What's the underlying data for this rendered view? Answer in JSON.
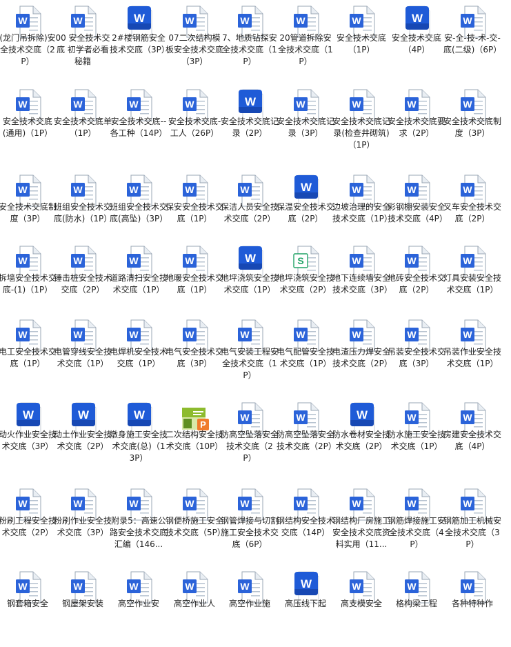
{
  "files": [
    {
      "label": "(龙门吊拆除)安全技术交底（2P）",
      "icon": "word-doc-icon"
    },
    {
      "label": "00 安全技术交底 初学者必看秘籍",
      "icon": "word-doc-icon"
    },
    {
      "label": "2#楼钢筋安全技术交底（3P）",
      "icon": "word-app-icon"
    },
    {
      "label": "07二次结构模板安全技术交底（3P）",
      "icon": "word-doc-icon"
    },
    {
      "label": "7、地质钻探安全技术交底（1P）",
      "icon": "word-doc-icon"
    },
    {
      "label": "20管道拆除安全技术交底（1P）",
      "icon": "word-doc-icon"
    },
    {
      "label": "安全技术交底（1P）",
      "icon": "word-doc-icon"
    },
    {
      "label": "安全技术交底（4P）",
      "icon": "word-app-icon"
    },
    {
      "label": "安-全-技-术-交-底(二级)（6P）",
      "icon": "word-doc-icon"
    },
    {
      "label": "安全技术交底(通用)（1P）",
      "icon": "word-doc-icon"
    },
    {
      "label": "安全技术交底单（1P）",
      "icon": "word-doc-icon"
    },
    {
      "label": "安全技术交底--各工种（14P）",
      "icon": "word-doc-icon"
    },
    {
      "label": "安全技术交底-工人（26P）",
      "icon": "word-doc-icon"
    },
    {
      "label": "安全技术交底记录（2P）",
      "icon": "word-app-icon"
    },
    {
      "label": "安全技术交底记录（3P）",
      "icon": "word-doc-icon"
    },
    {
      "label": "安全技术交底记录(检查井砌筑)（1P）",
      "icon": "word-doc-icon"
    },
    {
      "label": "安全技术交底要求（2P）",
      "icon": "word-doc-icon"
    },
    {
      "label": "安全技术交底制度（3P）",
      "icon": "word-doc-icon"
    },
    {
      "label": "安全技术交底制度（3P）",
      "icon": "word-doc-icon"
    },
    {
      "label": "班组安全技术交底(防水)（1P）",
      "icon": "word-doc-icon"
    },
    {
      "label": "班组安全技术交底(高坠)（3P）",
      "icon": "word-doc-icon"
    },
    {
      "label": "保安安全技术交底（1P）",
      "icon": "word-doc-icon"
    },
    {
      "label": "保洁人员安全技术交底（2P）",
      "icon": "word-doc-icon"
    },
    {
      "label": "保温安全技术交底（2P）",
      "icon": "word-app-icon"
    },
    {
      "label": "边坡治理的安全技术交底（1P）",
      "icon": "word-doc-icon"
    },
    {
      "label": "彩钢棚安装安全技术交底（4P）",
      "icon": "word-doc-icon"
    },
    {
      "label": "叉车安全技术交底（2P）",
      "icon": "word-doc-icon"
    },
    {
      "label": "拆墙安全技术交底-(1)（1P）",
      "icon": "word-doc-icon"
    },
    {
      "label": "锤击桩安全技术交底（2P）",
      "icon": "word-doc-icon"
    },
    {
      "label": "道路清扫安全技术交底（1P）",
      "icon": "word-doc-icon"
    },
    {
      "label": "地暖安全技术交底（1P）",
      "icon": "word-doc-icon"
    },
    {
      "label": "地坪浇筑安全技术交底（1P）",
      "icon": "word-app-icon"
    },
    {
      "label": "地坪浇筑安全技术交底（2P）",
      "icon": "sheet-doc-icon"
    },
    {
      "label": "地下连续墙安全技术交底（3P）",
      "icon": "word-doc-icon"
    },
    {
      "label": "地砖安全技术交底（2P）",
      "icon": "word-doc-icon"
    },
    {
      "label": "灯具安装安全技术交底（1P）",
      "icon": "word-doc-icon"
    },
    {
      "label": "电工安全技术交底（1P）",
      "icon": "word-doc-icon"
    },
    {
      "label": "电管穿线安全技术交底（1P）",
      "icon": "word-doc-icon"
    },
    {
      "label": "电焊机安全技术交底（1P）",
      "icon": "word-doc-icon"
    },
    {
      "label": "电气安全技术交底（3P）",
      "icon": "word-doc-icon"
    },
    {
      "label": "电气安装工程安全技术交底（1P）",
      "icon": "word-doc-icon"
    },
    {
      "label": "电气配管安全技术交底（1P）",
      "icon": "word-doc-icon"
    },
    {
      "label": "电渣压力焊安全技术交底（2P）",
      "icon": "word-doc-icon"
    },
    {
      "label": "吊装安全技术交底（3P）",
      "icon": "word-doc-icon"
    },
    {
      "label": "吊装作业安全技术交底（1P）",
      "icon": "word-doc-icon"
    },
    {
      "label": "动火作业安全技术交底（3P）",
      "icon": "word-app-icon"
    },
    {
      "label": "动土作业安全技术交底（2P）",
      "icon": "word-app-icon"
    },
    {
      "label": "墩身施工安全技术交底(总)（13P）",
      "icon": "word-app-icon"
    },
    {
      "label": "二次结构安全技术交底（10P）",
      "icon": "thumbnail-icon"
    },
    {
      "label": "防高空坠落安全技术交底（2 P）",
      "icon": "word-doc-icon"
    },
    {
      "label": "防高空坠落安全技术交底（2P）",
      "icon": "word-doc-icon"
    },
    {
      "label": "防水卷材安全技术交底（2P）",
      "icon": "word-app-icon"
    },
    {
      "label": "防水施工安全技术交底（1P）",
      "icon": "word-doc-icon"
    },
    {
      "label": "房建安全技术交底（4P）",
      "icon": "word-doc-icon"
    },
    {
      "label": "粉刷工程安全技术交底（2P）",
      "icon": "word-doc-icon"
    },
    {
      "label": "粉刷作业安全技术交底（3P）",
      "icon": "word-doc-icon"
    },
    {
      "label": "附录5：高速公路安全技术交底汇编（146...",
      "icon": "word-doc-icon"
    },
    {
      "label": "钢便桥施工安全技术交底（5P）",
      "icon": "word-doc-icon"
    },
    {
      "label": "钢管焊接与切割施工安全技术交底（6P）",
      "icon": "word-doc-icon"
    },
    {
      "label": "钢结构安全技术交底（14P）",
      "icon": "word-doc-icon"
    },
    {
      "label": "钢结构厂房施工安全技术交底资料实用（11...",
      "icon": "word-doc-icon"
    },
    {
      "label": "钢筋焊接施工安全技术交底（4P）",
      "icon": "word-doc-icon"
    },
    {
      "label": "钢筋加工机械安全技术交底（3P）",
      "icon": "word-doc-icon"
    },
    {
      "label": "钢套箱安全",
      "icon": "word-doc-icon"
    },
    {
      "label": "钢屋架安装",
      "icon": "word-doc-icon"
    },
    {
      "label": "高空作业安",
      "icon": "word-doc-icon"
    },
    {
      "label": "高空作业人",
      "icon": "word-doc-icon"
    },
    {
      "label": "高空作业施",
      "icon": "word-doc-icon"
    },
    {
      "label": "高压线下起",
      "icon": "word-app-icon"
    },
    {
      "label": "高支模安全",
      "icon": "word-doc-icon"
    },
    {
      "label": "格构梁工程",
      "icon": "word-doc-icon"
    },
    {
      "label": "各种特种作",
      "icon": "word-doc-icon"
    }
  ],
  "sheet_letter": "S",
  "word_letter": "W",
  "thumb_badge": "P",
  "thumb_caption": "二次结构"
}
